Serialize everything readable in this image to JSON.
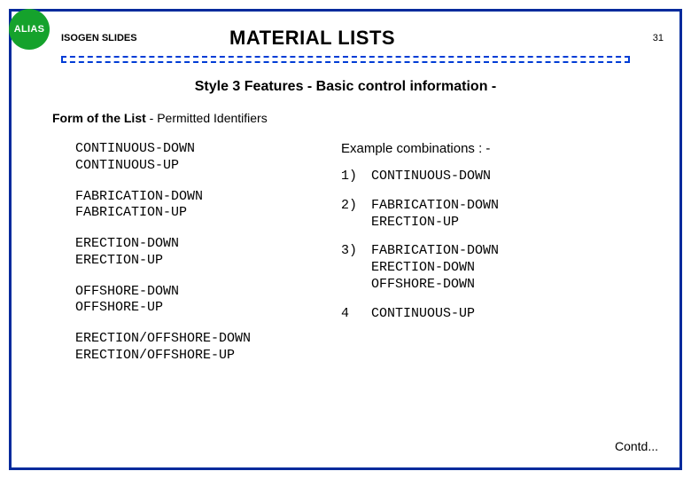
{
  "badge": "ALIAS",
  "header": {
    "left": "ISOGEN SLIDES",
    "title": "MATERIAL LISTS",
    "page": "31"
  },
  "subtitle": "Style 3 Features - Basic control information -",
  "section": {
    "bold": "Form of the List",
    "rest": " - Permitted Identifiers"
  },
  "identifiers": {
    "g1a": "CONTINUOUS-DOWN",
    "g1b": "CONTINUOUS-UP",
    "g2a": "FABRICATION-DOWN",
    "g2b": "FABRICATION-UP",
    "g3a": "ERECTION-DOWN",
    "g3b": "ERECTION-UP",
    "g4a": "OFFSHORE-DOWN",
    "g4b": "OFFSHORE-UP",
    "g5a": "ERECTION/OFFSHORE-DOWN",
    "g5b": "ERECTION/OFFSHORE-UP"
  },
  "examples": {
    "heading": "Example combinations : -",
    "rows": [
      {
        "num": "1)",
        "l1": "CONTINUOUS-DOWN"
      },
      {
        "num": "2)",
        "l1": "FABRICATION-DOWN",
        "l2": "ERECTION-UP"
      },
      {
        "num": "3)",
        "l1": "FABRICATION-DOWN",
        "l2": "ERECTION-DOWN",
        "l3": "OFFSHORE-DOWN"
      },
      {
        "num": "4",
        "l1": "CONTINUOUS-UP"
      }
    ]
  },
  "contd": "Contd..."
}
